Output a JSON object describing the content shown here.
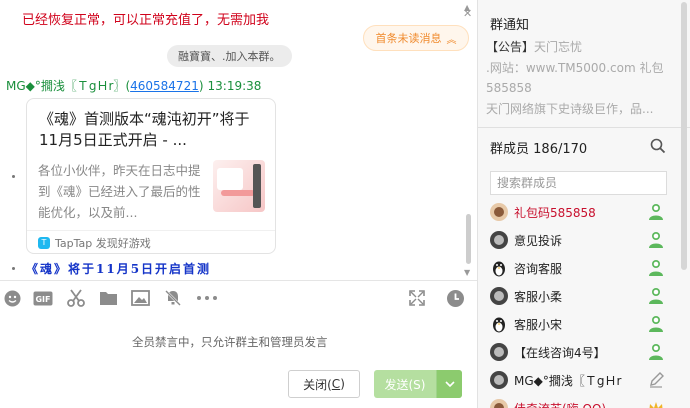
{
  "chat": {
    "system_red_message": "已经恢复正常，可以正常充值了，无需加我",
    "unread_label": "首条未读消息",
    "system_notice": "融寶寶、.加入本群。",
    "message": {
      "sender": "MG◆°撊浅〖ＴgＨr〗",
      "qq": "460584721",
      "time": "13:19:38"
    },
    "card": {
      "title": "《魂》首测版本“魂沌初开”将于11月5日正式开启 - ...",
      "description": "各位小伙伴，昨天在日志中提到《魂》已经进入了最后的性能优化，以及前...",
      "source": "TapTap 发现好游戏",
      "source_logo": "T"
    },
    "blue_message": "《魂》将于11月5日开启首测",
    "toolbar_icons": [
      "emoji-icon",
      "gif-icon",
      "scissors-icon",
      "folder-icon",
      "image-icon",
      "mute-bell-icon",
      "more-icon",
      "expand-icon",
      "history-clock-icon"
    ],
    "muted_text": "全员禁言中，只允许群主和管理员发言",
    "close_button": {
      "label": "关闭(",
      "key": "C",
      "end": ")"
    },
    "send_button": {
      "label": "发送(S)"
    }
  },
  "sidebar": {
    "notice_title": "群通知",
    "notice_tag": "【公告】",
    "notice_line1_rest": "天门忘忧",
    "notice_line2": ".网站：www.TM5000.com 礼包",
    "notice_line3": "585858",
    "notice_line4": "天门网络旗下史诗级巨作，品...",
    "members_label": "群成员",
    "members_count": "186/170",
    "search_placeholder": "搜索群成员",
    "members": [
      {
        "name": "礼包码585858",
        "highlight": true,
        "avatar": "photo",
        "role": "admin"
      },
      {
        "name": "意见投诉",
        "highlight": false,
        "avatar": "dark",
        "role": "admin"
      },
      {
        "name": "咨询客服",
        "highlight": false,
        "avatar": "penguin",
        "role": "admin"
      },
      {
        "name": "客服小柔",
        "highlight": false,
        "avatar": "dark",
        "role": "admin"
      },
      {
        "name": "客服小宋",
        "highlight": false,
        "avatar": "penguin",
        "role": "admin"
      },
      {
        "name": "【在线咨询4号】",
        "highlight": false,
        "avatar": "dark",
        "role": "admin"
      },
      {
        "name": "MG◆°撊浅〖ＴgＨr",
        "highlight": false,
        "avatar": "dark",
        "role": "edit"
      },
      {
        "name": "佳奇流苏(嗨 QQ)",
        "highlight": true,
        "avatar": "photo",
        "role": "star"
      }
    ]
  },
  "colors": {
    "admin_green": "#5cb85c",
    "owner_gold": "#f0b429",
    "send_green": "#b5dfa0"
  }
}
